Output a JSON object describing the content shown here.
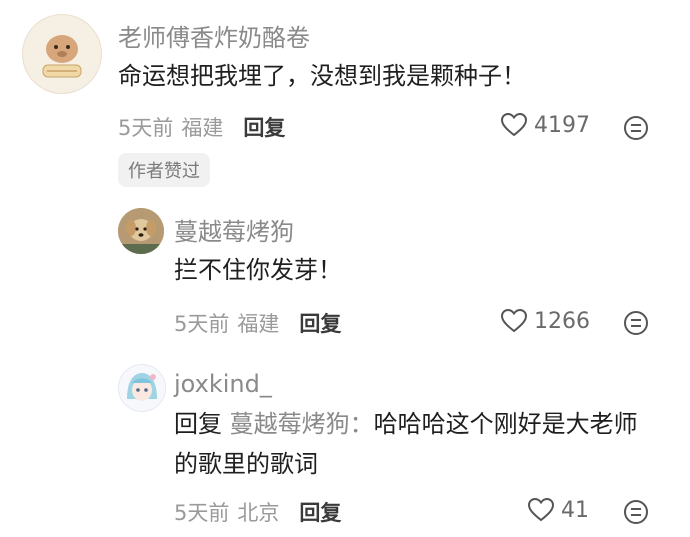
{
  "comments": [
    {
      "username": "老师傅香炸奶酪卷",
      "text": "命运想把我埋了，没想到我是颗种子！",
      "time": "5天前",
      "location": "福建",
      "reply_label": "回复",
      "likes": "4197",
      "badge": "作者赞过"
    },
    {
      "username": "蔓越莓烤狗",
      "text": "拦不住你发芽！",
      "time": "5天前",
      "location": "福建",
      "reply_label": "回复",
      "likes": "1266"
    },
    {
      "username": "joxkind_",
      "reply_prefix": "回复",
      "reply_to": "蔓越莓烤狗",
      "reply_colon": "：",
      "text": "哈哈哈这个刚好是大老师的歌里的歌词",
      "time": "5天前",
      "location": "北京",
      "reply_label": "回复",
      "likes": "41"
    }
  ],
  "icons": {
    "like": "heart-outline-icon",
    "more": "emoji-face-icon"
  },
  "colors": {
    "secondary_text": "#8a8a8a",
    "primary_text": "#1f1f1f",
    "badge_bg": "#f1f1f1"
  }
}
